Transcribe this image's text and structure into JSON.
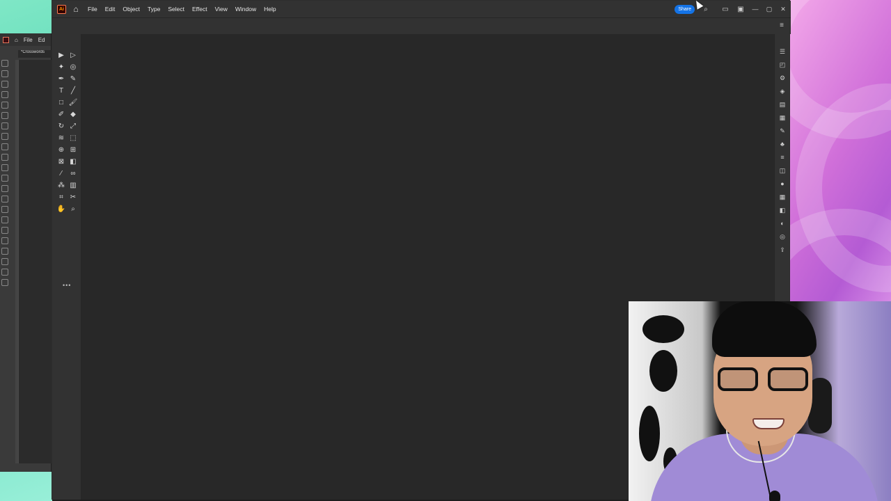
{
  "app": {
    "logo_text": "Ai",
    "menu": [
      "File",
      "Edit",
      "Object",
      "Type",
      "Select",
      "Effect",
      "View",
      "Window",
      "Help"
    ],
    "share_label": "Share"
  },
  "background_window": {
    "menu": [
      "File",
      "Ed"
    ],
    "tab_title": "*Crosswords"
  },
  "icons": {
    "home": "home-icon",
    "search": "search-icon",
    "arrange": "arrange-documents-icon",
    "minimize": "minimize-icon",
    "maximize": "maximize-icon",
    "close": "close-icon",
    "panel_menu": "hamburger-menu-icon",
    "more_tools": "more-tools-icon"
  },
  "toolbar": {
    "tools": [
      {
        "name": "selection-tool",
        "glyph": "▶"
      },
      {
        "name": "direct-selection-tool",
        "glyph": "▷"
      },
      {
        "name": "magic-wand-tool",
        "glyph": "✦"
      },
      {
        "name": "lasso-tool",
        "glyph": "◎"
      },
      {
        "name": "pen-tool",
        "glyph": "✒"
      },
      {
        "name": "curvature-tool",
        "glyph": "✎"
      },
      {
        "name": "type-tool",
        "glyph": "T"
      },
      {
        "name": "line-segment-tool",
        "glyph": "╱"
      },
      {
        "name": "rectangle-tool",
        "glyph": "□"
      },
      {
        "name": "paintbrush-tool",
        "glyph": "🖌"
      },
      {
        "name": "shaper-tool",
        "glyph": "✐"
      },
      {
        "name": "eraser-tool",
        "glyph": "◆"
      },
      {
        "name": "rotate-tool",
        "glyph": "↻"
      },
      {
        "name": "scale-tool",
        "glyph": "⤢"
      },
      {
        "name": "warp-tool",
        "glyph": "≋"
      },
      {
        "name": "free-transform-tool",
        "glyph": "⬚"
      },
      {
        "name": "shape-builder-tool",
        "glyph": "⊕"
      },
      {
        "name": "perspective-grid-tool",
        "glyph": "⊞"
      },
      {
        "name": "mesh-tool",
        "glyph": "⊠"
      },
      {
        "name": "gradient-tool",
        "glyph": "◧"
      },
      {
        "name": "eyedropper-tool",
        "glyph": "⁄"
      },
      {
        "name": "blend-tool",
        "glyph": "∞"
      },
      {
        "name": "symbol-sprayer-tool",
        "glyph": "⁂"
      },
      {
        "name": "column-graph-tool",
        "glyph": "▥"
      },
      {
        "name": "artboard-tool",
        "glyph": "⌗"
      },
      {
        "name": "slice-tool",
        "glyph": "✂"
      },
      {
        "name": "hand-tool",
        "glyph": "✋"
      },
      {
        "name": "zoom-tool",
        "glyph": "⌕"
      }
    ],
    "more_label": "•••"
  },
  "right_dock": {
    "icons": [
      "properties-icon",
      "libraries-icon",
      "adjustments-icon",
      "layers-icon",
      "artboards-icon",
      "assets-icon",
      "brushes-icon",
      "symbols-icon",
      "align-icon",
      "transform-icon",
      "color-icon",
      "swatches-icon",
      "pathfinder-icon",
      "appearance-icon",
      "graphic-styles-icon",
      "export-icon"
    ]
  },
  "colors": {
    "accent": "#1473e6",
    "canvas": "#282828",
    "chrome": "#323232"
  }
}
